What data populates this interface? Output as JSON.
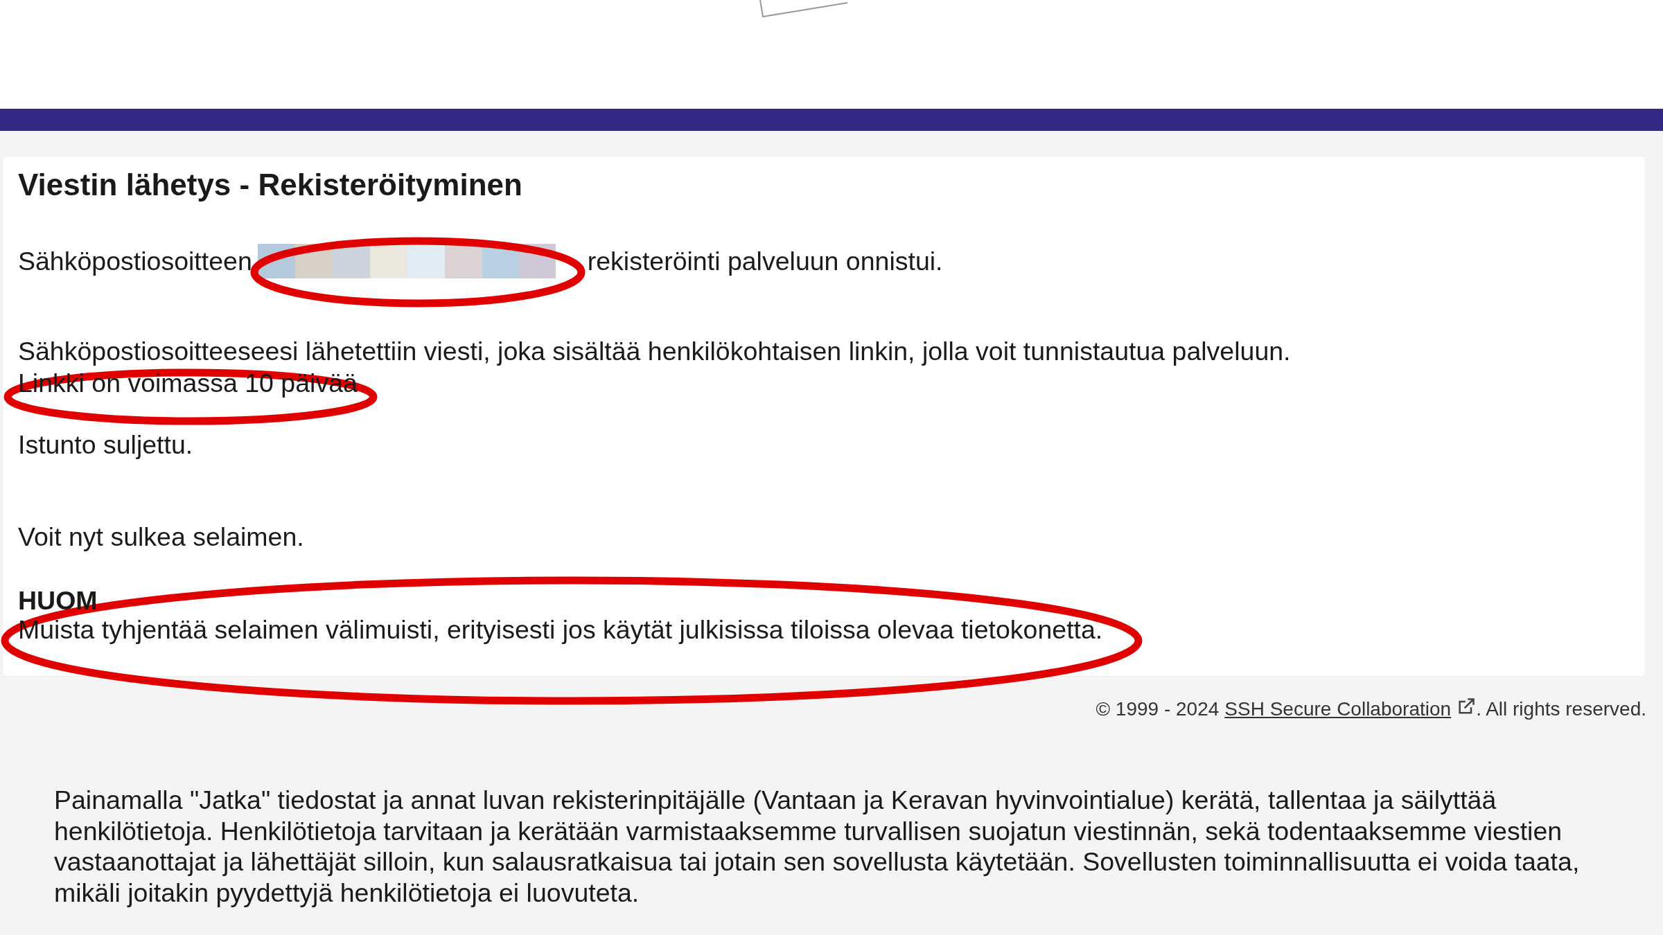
{
  "title": "Viestin lähetys - Rekisteröityminen",
  "registration": {
    "before": "Sähköpostiosoitteen",
    "after": "rekisteröinti palveluun onnistui."
  },
  "message": {
    "line_1": "Sähköpostiosoitteeseesi lähetettiin viesti, joka sisältää henkilökohtaisen linkin, jolla voit tunnistautua palveluun.",
    "line_2": "Linkki on voimassa 10 päivää"
  },
  "session": "Istunto suljettu.",
  "close_hint": "Voit nyt sulkea selaimen.",
  "note": {
    "heading": "HUOM",
    "text": "Muista tyhjentää selaimen välimuisti, erityisesti jos käytät julkisissa tiloissa olevaa tietokonetta."
  },
  "footer": {
    "prefix": "© 1999 - 2024",
    "link": "SSH Secure Collaboration",
    "suffix": ". All rights reserved."
  },
  "disclaimer": "Painamalla \"Jatka\" tiedostat ja annat luvan rekisterinpitäjälle (Vantaan ja Keravan hyvinvointialue) kerätä, tallentaa ja säilyttää henkilötietoja. Henkilötietoja tarvitaan ja kerätään varmistaaksemme turvallisen suojatun viestinnän, sekä todentaaksemme viestien vastaanottajat ja lähettäjät silloin, kun salausratkaisua tai jotain sen sovellusta käytetään. Sovellusten toiminnallisuutta ei voida taata, mikäli joitakin pyydettyjä henkilötietoja ei luovuteta."
}
